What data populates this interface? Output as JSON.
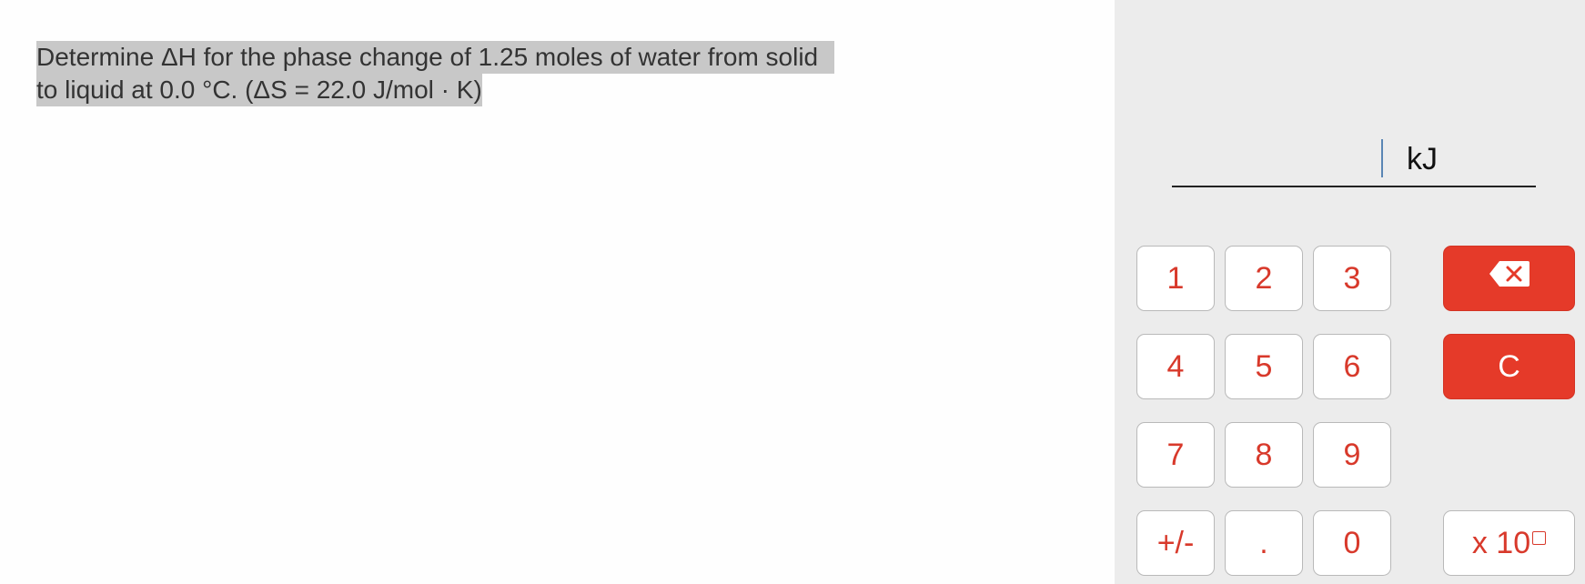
{
  "question": {
    "line1": "Determine ΔH for the phase change of 1.25 moles of water from solid",
    "line2": "to liquid at 0.0 °C. (ΔS = 22.0 J/mol · K)"
  },
  "answer": {
    "value": "",
    "unit": "kJ"
  },
  "keypad": {
    "k1": "1",
    "k2": "2",
    "k3": "3",
    "k4": "4",
    "k5": "5",
    "k6": "6",
    "k7": "7",
    "k8": "8",
    "k9": "9",
    "k0": "0",
    "sign": "+/-",
    "dot": ".",
    "clear": "C",
    "exp": "x 10",
    "backspace_icon": "backspace-icon",
    "exponent_box_icon": "square-box-icon"
  },
  "colors": {
    "accent": "#e53a29",
    "key_text": "#d8392b",
    "panel_bg": "#ececec",
    "highlight": "#c8c8c8",
    "cursor": "#5a86b4"
  }
}
